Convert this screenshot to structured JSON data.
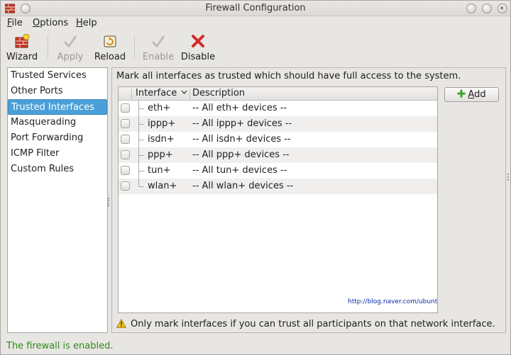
{
  "window": {
    "title": "Firewall Configuration"
  },
  "menu": [
    {
      "mnemonic": "F",
      "rest": "ile"
    },
    {
      "mnemonic": "O",
      "rest": "ptions"
    },
    {
      "mnemonic": "H",
      "rest": "elp"
    }
  ],
  "toolbar": {
    "wizard": "Wizard",
    "apply": "Apply",
    "reload": "Reload",
    "enable": "Enable",
    "disable": "Disable"
  },
  "sidebar": {
    "items": [
      "Trusted Services",
      "Other Ports",
      "Trusted Interfaces",
      "Masquerading",
      "Port Forwarding",
      "ICMP Filter",
      "Custom Rules"
    ],
    "selected_index": 2
  },
  "main": {
    "description": "Mark all interfaces as trusted which should have full access to the system.",
    "columns": {
      "interface": "Interface",
      "description": "Description"
    },
    "rows": [
      {
        "interface": "eth+",
        "description": "-- All eth+ devices --",
        "checked": false
      },
      {
        "interface": "ippp+",
        "description": "-- All ippp+ devices --",
        "checked": false
      },
      {
        "interface": "isdn+",
        "description": "-- All isdn+ devices --",
        "checked": false
      },
      {
        "interface": "ppp+",
        "description": "-- All ppp+ devices --",
        "checked": false
      },
      {
        "interface": "tun+",
        "description": "-- All tun+ devices --",
        "checked": false
      },
      {
        "interface": "wlan+",
        "description": "-- All wlan+ devices --",
        "checked": false
      }
    ],
    "watermark": "http://blog.naver.com/ubuntuk",
    "add_button": {
      "mnemonic": "A",
      "rest": "dd"
    },
    "warning": "Only mark interfaces if you can trust all participants on that network interface."
  },
  "status": "The firewall is enabled.",
  "colors": {
    "selection": "#4a9fd8",
    "status_text": "#2d8a1b",
    "disable_icon": "#d42a2a",
    "add_icon": "#3ea32b"
  },
  "icons": {
    "app": "firewall-brick-icon",
    "wizard": "wizard-brick-icon",
    "apply": "checkmark-icon",
    "reload": "reload-icon",
    "enable": "checkmark-icon",
    "disable": "red-x-icon",
    "add": "green-plus-icon",
    "warning": "warning-triangle-icon"
  }
}
